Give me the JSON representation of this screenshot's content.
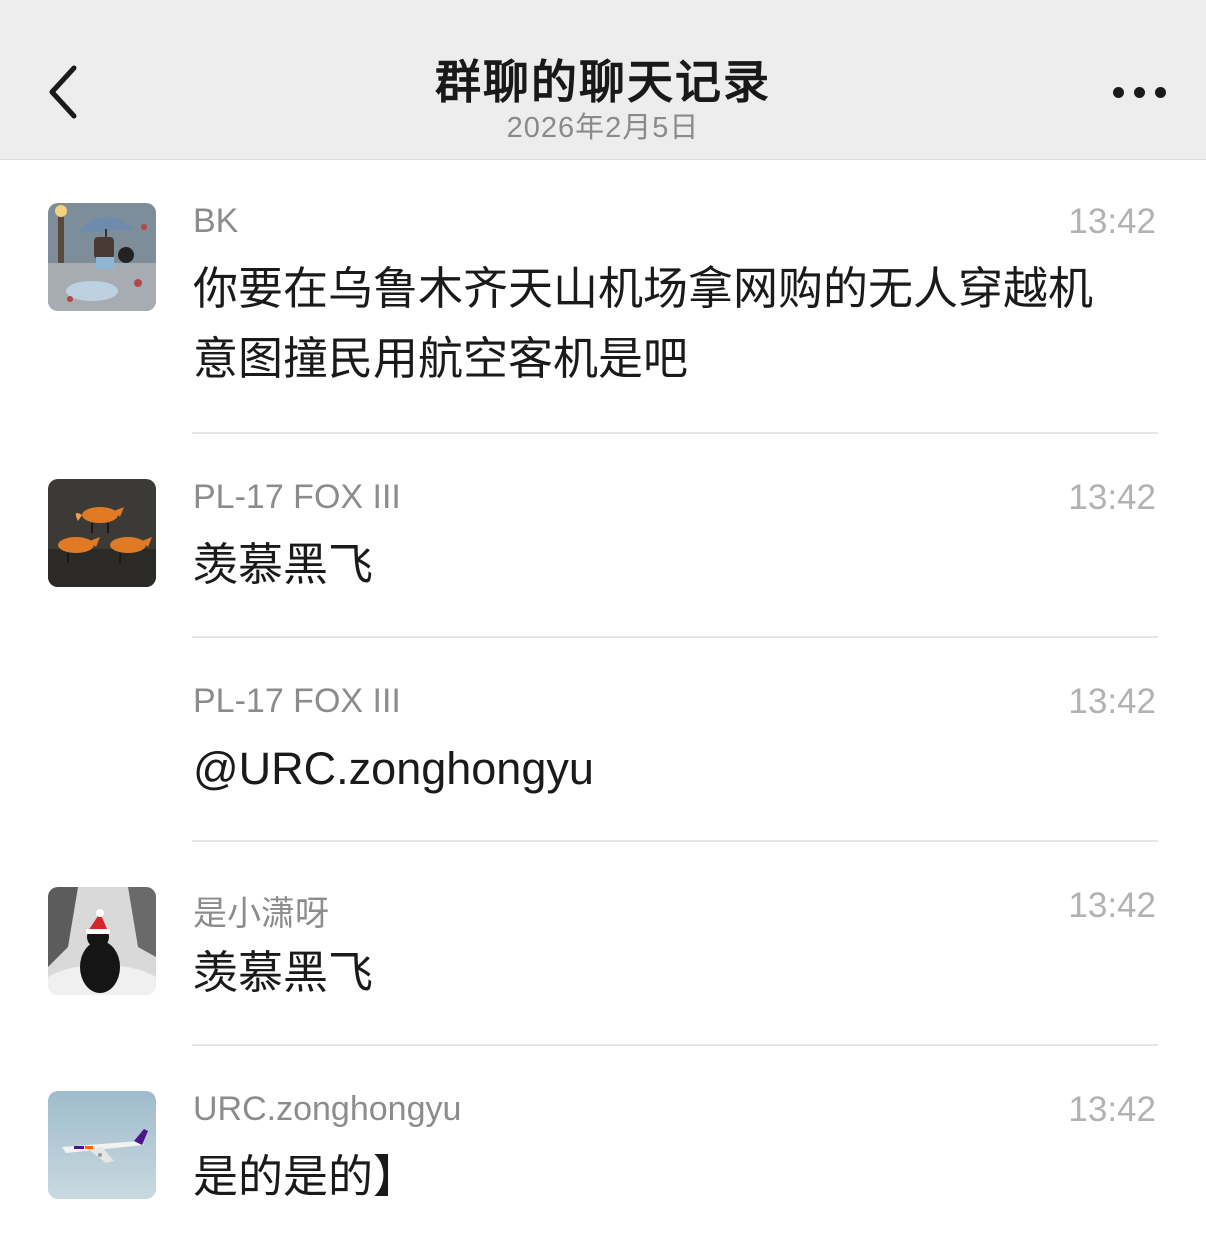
{
  "header": {
    "title": "群聊的聊天记录",
    "date": "2026年2月5日",
    "back_icon": "chevron-left-icon",
    "more_icon": "more-horizontal-icon"
  },
  "messages": [
    {
      "sender": "BK",
      "time": "13:42",
      "text_line1": "你要在乌鲁木齐天山机场拿网购的无人穿越机",
      "text_line2": "意图撞民用航空客机是吧"
    },
    {
      "sender": "PL-17 FOX III",
      "time": "13:42",
      "text": "羡慕黑飞"
    },
    {
      "sender": "PL-17 FOX III",
      "time": "13:42",
      "text": "@URC.zonghongyu"
    },
    {
      "sender": "是小潇呀",
      "time": "13:42",
      "text": "羡慕黑飞"
    },
    {
      "sender": "URC.zonghongyu",
      "time": "13:42",
      "text": "是的是的】"
    }
  ]
}
